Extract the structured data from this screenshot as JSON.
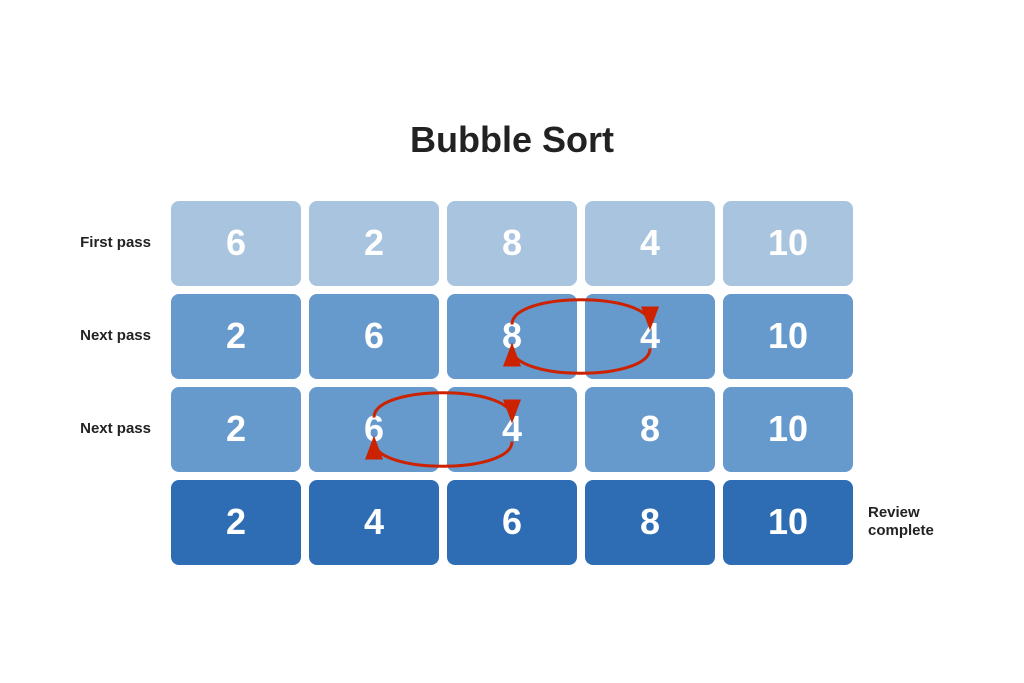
{
  "title": "Bubble Sort",
  "rows": [
    {
      "label": "First pass",
      "label_right": "",
      "cells": [
        {
          "value": "6",
          "shade": "light"
        },
        {
          "value": "2",
          "shade": "light"
        },
        {
          "value": "8",
          "shade": "light"
        },
        {
          "value": "4",
          "shade": "light"
        },
        {
          "value": "10",
          "shade": "light"
        }
      ],
      "arrow": null
    },
    {
      "label": "Next pass",
      "label_right": "",
      "cells": [
        {
          "value": "2",
          "shade": "mid"
        },
        {
          "value": "6",
          "shade": "mid"
        },
        {
          "value": "8",
          "shade": "mid"
        },
        {
          "value": "4",
          "shade": "mid"
        },
        {
          "value": "10",
          "shade": "mid"
        }
      ],
      "arrow": {
        "from_cell": 2,
        "to_cell": 3
      }
    },
    {
      "label": "Next pass",
      "label_right": "",
      "cells": [
        {
          "value": "2",
          "shade": "mid"
        },
        {
          "value": "6",
          "shade": "mid"
        },
        {
          "value": "4",
          "shade": "mid"
        },
        {
          "value": "8",
          "shade": "mid"
        },
        {
          "value": "10",
          "shade": "mid"
        }
      ],
      "arrow": {
        "from_cell": 1,
        "to_cell": 2
      }
    },
    {
      "label": "",
      "label_right": "Review complete",
      "cells": [
        {
          "value": "2",
          "shade": "dark"
        },
        {
          "value": "4",
          "shade": "dark"
        },
        {
          "value": "6",
          "shade": "dark"
        },
        {
          "value": "8",
          "shade": "dark"
        },
        {
          "value": "10",
          "shade": "dark"
        }
      ],
      "arrow": null
    }
  ]
}
